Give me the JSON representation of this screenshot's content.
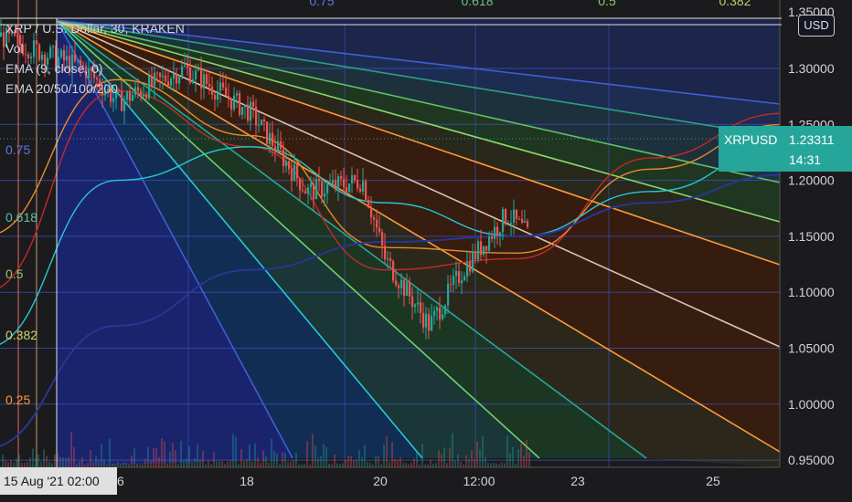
{
  "legend": {
    "symbol_line": "XRP / U.S. Dollar, 30, KRAKEN",
    "vol": "Vol",
    "ema1": "EMA (9, close, 0)",
    "ema2": "EMA 20/50/100/200"
  },
  "currency_button": "USD",
  "price_label": {
    "symbol": "XRPUSD",
    "price": "1.23311",
    "countdown": "14:31"
  },
  "crosshair_time": "15 Aug '21  02:00",
  "fib_top_labels": [
    "0.75",
    "0.618",
    "0.5",
    "0.382"
  ],
  "fib_left_labels": [
    "0.75",
    "0.618",
    "0.5",
    "0.382",
    "0.25"
  ],
  "colors": {
    "background": "#1b1b1d",
    "candle_up": "#26a69a",
    "candle_down": "#ef5350",
    "ema_red": "#c62828",
    "ema_orange": "#e68a2e",
    "ema_teal": "#26c6da",
    "ema_navy": "#283593"
  },
  "chart_data": {
    "type": "line",
    "title": "XRP / U.S. Dollar, 30, KRAKEN",
    "y_axis_ticks": [
      "1.30000",
      "1.25000",
      "1.20000",
      "1.15000",
      "1.10000",
      "1.05000",
      "1.00000",
      "0.95000"
    ],
    "y_axis_top_partial": "1.35000",
    "x_axis_ticks": [
      "16",
      "18",
      "20",
      "12:00",
      "23",
      "25"
    ],
    "ylim": [
      0.95,
      1.35
    ],
    "last_price": 1.23311,
    "price_series": {
      "name": "XRPUSD",
      "points": [
        [
          "15 Aug 00:00",
          1.195
        ],
        [
          "15 Aug 02:00",
          1.33
        ],
        [
          "15 Aug 18:00",
          1.3
        ],
        [
          "16 Aug 00:00",
          1.27
        ],
        [
          "16 Aug 12:00",
          1.3
        ],
        [
          "17 Aug 00:00",
          1.26
        ],
        [
          "17 Aug 10:00",
          1.19
        ],
        [
          "17 Aug 20:00",
          1.2
        ],
        [
          "18 Aug 00:00",
          1.13
        ],
        [
          "18 Aug 08:00",
          1.07
        ],
        [
          "18 Aug 14:00",
          1.12
        ],
        [
          "18 Aug 22:00",
          1.17
        ],
        [
          "19 Aug 04:00",
          1.14
        ],
        [
          "19 Aug 10:00",
          1.16
        ],
        [
          "19 Aug 16:00",
          1.1
        ],
        [
          "20 Aug 00:00",
          1.18
        ],
        [
          "20 Aug 06:00",
          1.22
        ],
        [
          "20 Aug 12:00",
          1.26
        ],
        [
          "20 Aug 18:00",
          1.28
        ],
        [
          "21 Aug 00:00",
          1.26
        ],
        [
          "21 Aug 06:00",
          1.27
        ],
        [
          "21 Aug 12:00",
          1.245
        ],
        [
          "21 Aug 18:00",
          1.225
        ],
        [
          "22 Aug 00:00",
          1.233
        ]
      ]
    },
    "ema_series": [
      {
        "color": "#c62828",
        "points": [
          [
            "15 Aug",
            1.1
          ],
          [
            "16 Aug",
            1.28
          ],
          [
            "17 Aug",
            1.23
          ],
          [
            "18 Aug",
            1.12
          ],
          [
            "19 Aug",
            1.13
          ],
          [
            "20 Aug",
            1.22
          ],
          [
            "21 Aug",
            1.26
          ],
          [
            "22 Aug",
            1.232
          ]
        ]
      },
      {
        "color": "#e68a2e",
        "points": [
          [
            "15 Aug",
            1.15
          ],
          [
            "16 Aug",
            1.29
          ],
          [
            "17 Aug",
            1.24
          ],
          [
            "18 Aug",
            1.14
          ],
          [
            "19 Aug",
            1.135
          ],
          [
            "20 Aug",
            1.21
          ],
          [
            "21 Aug",
            1.25
          ],
          [
            "22 Aug",
            1.233
          ]
        ]
      },
      {
        "color": "#26c6da",
        "points": [
          [
            "15 Aug",
            1.05
          ],
          [
            "16 Aug",
            1.2
          ],
          [
            "17 Aug",
            1.23
          ],
          [
            "18 Aug",
            1.18
          ],
          [
            "19 Aug",
            1.15
          ],
          [
            "20 Aug",
            1.19
          ],
          [
            "21 Aug",
            1.23
          ],
          [
            "22 Aug",
            1.228
          ]
        ]
      },
      {
        "color": "#283593",
        "points": [
          [
            "15 Aug",
            0.96
          ],
          [
            "16 Aug",
            1.07
          ],
          [
            "17 Aug",
            1.12
          ],
          [
            "18 Aug",
            1.145
          ],
          [
            "19 Aug",
            1.15
          ],
          [
            "20 Aug",
            1.18
          ],
          [
            "21 Aug",
            1.205
          ],
          [
            "22 Aug",
            1.21
          ]
        ]
      }
    ]
  }
}
